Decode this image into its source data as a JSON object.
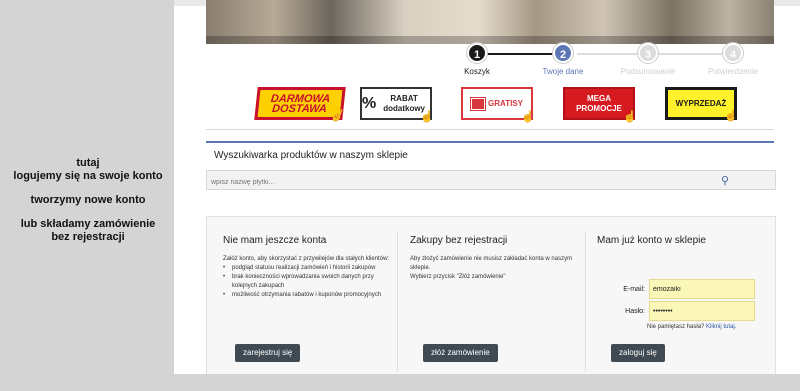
{
  "annotations": {
    "line1": "tutaj",
    "line2": "logujemy się na swoje konto",
    "line3": "tworzymy nowe konto",
    "line4": "lub składamy zamówienie",
    "line5": "bez rejestracji"
  },
  "steps": [
    {
      "num": "1",
      "label": "Koszyk"
    },
    {
      "num": "2",
      "label": "Twoje dane"
    },
    {
      "num": "3",
      "label": "Podsumowanie"
    },
    {
      "num": "4",
      "label": "Potwierdzenie"
    }
  ],
  "promos": {
    "darmowa": "DARMOWA DOSTAWA",
    "rabat_pct": "%",
    "rabat": "RABAT dodatkowy",
    "gratisy": "GRATISY",
    "mega": "MEGA PROMOCJE",
    "wyprzedaz": "WYPRZEDAŻ"
  },
  "search": {
    "title": "Wyszukiwarka produktów w naszym sklepie",
    "placeholder": "wpisz nazwę płytki..."
  },
  "panels": {
    "new_account": {
      "title": "Nie mam jeszcze konta",
      "intro": "Załóż konto, aby skorzystać z przywilejów dla stałych klientów:",
      "bullets": [
        "podgląd statusu realizacji zamówień i historii zakupów",
        "brak konieczności wprowadzania swoich danych przy kolejnych zakupach",
        "możliwość otrzymania rabatów i kuponów promocyjnych"
      ],
      "button": "zarejestruj się"
    },
    "guest": {
      "title": "Zakupy bez rejestracji",
      "text": "Aby złożyć zamówienie nie musisz zakładać konta w naszym sklepie.",
      "text2": "Wybierz przycisk \"Złóż zamówienie\"",
      "button": "złóż zamówienie"
    },
    "login": {
      "title": "Mam już konto w sklepie",
      "email_label": "E-mail:",
      "email_value": "emozaiki",
      "password_label": "Hasło:",
      "password_value": "••••••••",
      "forgot_text": "Nie pamiętasz hasła?",
      "forgot_link": "Kliknij tutaj.",
      "button": "zaloguj się"
    }
  },
  "colors": {
    "accent": "#5b77b5",
    "button": "#3f4a52",
    "input_highlight": "#fbf7b8"
  }
}
